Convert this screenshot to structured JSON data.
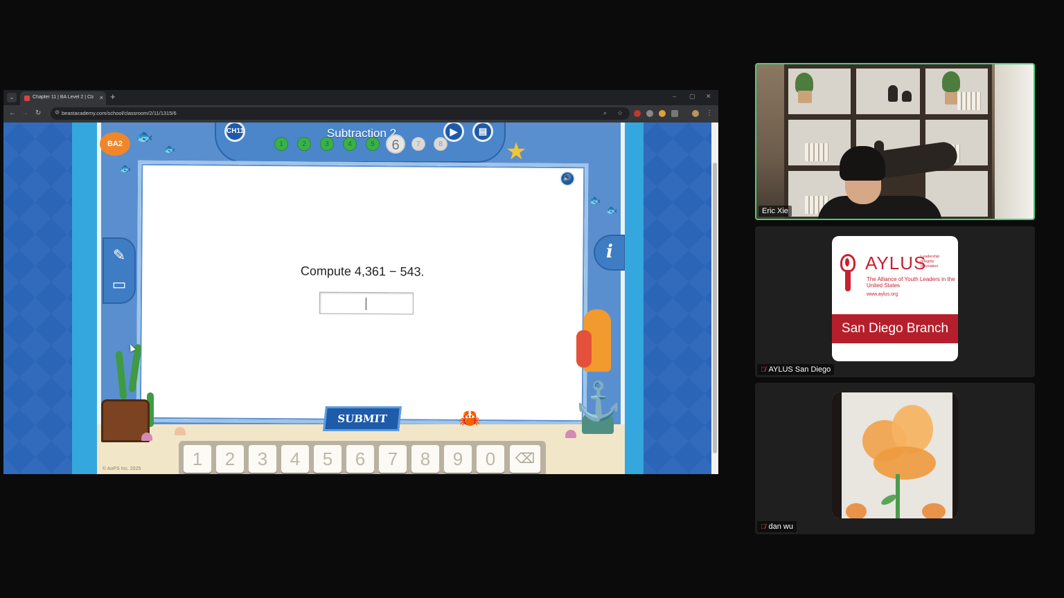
{
  "browser": {
    "tab_title": "Chapter 11 | BA Level 2 | Class",
    "tab_close": "×",
    "new_tab": "+",
    "tab_dropdown": "⌄",
    "url": "beastacademy.com/school/classroom/2/11/1315/6",
    "window_controls": [
      "–",
      "▢",
      "✕"
    ]
  },
  "game": {
    "chapter_chip": "CH11",
    "logo": "BA2",
    "lesson_title": "Subtraction 2",
    "progress": [
      {
        "n": "1",
        "state": "done"
      },
      {
        "n": "2",
        "state": "done"
      },
      {
        "n": "3",
        "state": "done"
      },
      {
        "n": "4",
        "state": "done"
      },
      {
        "n": "5",
        "state": "done"
      },
      {
        "n": "6",
        "state": "current"
      },
      {
        "n": "7",
        "state": "todo"
      },
      {
        "n": "8",
        "state": "todo"
      }
    ],
    "question": "Compute 4,361 − 543.",
    "answer_value": "",
    "submit_label": "SUBMIT",
    "keypad": [
      "1",
      "2",
      "3",
      "4",
      "5",
      "6",
      "7",
      "8",
      "9",
      "0"
    ],
    "backspace_symbol": "⌫",
    "copyright": "© AoPS Inc. 2025",
    "info_symbol": "i"
  },
  "participants": [
    {
      "name": "Eric Xie",
      "muted": false,
      "active_speaker": true
    },
    {
      "name": "AYLUS San Diego",
      "muted": true,
      "active_speaker": false
    },
    {
      "name": "dan wu",
      "muted": true,
      "active_speaker": false
    }
  ],
  "aylus_logo": {
    "word": "AYLUS",
    "tagline": [
      "Leadership",
      "Integrity",
      "Innovation"
    ],
    "full_name": "The Alliance of Youth Leaders in the United States",
    "url": "www.aylus.org",
    "branch": "San Diego Branch"
  },
  "colors": {
    "active_speaker_border": "#43d17a",
    "aylus_red": "#c8202f",
    "progress_done": "#3bb04a"
  }
}
